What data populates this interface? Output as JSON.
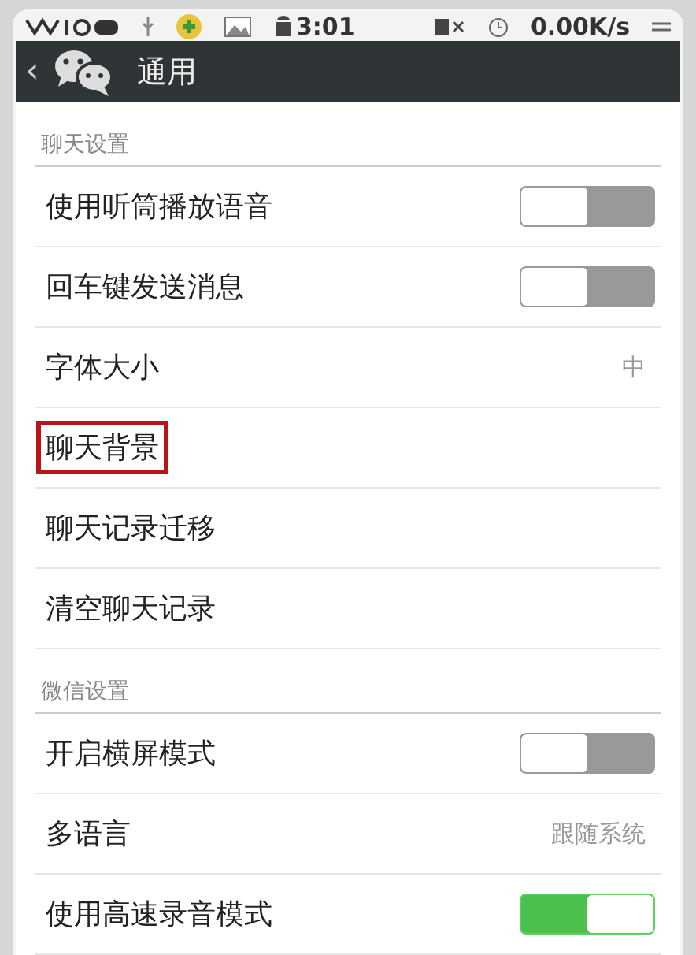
{
  "status_bar": {
    "time": "3:01",
    "speed": "0.00K/s"
  },
  "header": {
    "back": "‹",
    "title": "通用"
  },
  "sections": [
    {
      "title": "聊天设置",
      "items": [
        {
          "kind": "toggle",
          "label": "使用听筒播放语音",
          "on": false,
          "highlighted": false
        },
        {
          "kind": "toggle",
          "label": "回车键发送消息",
          "on": false,
          "highlighted": false
        },
        {
          "kind": "value",
          "label": "字体大小",
          "value": "中",
          "highlighted": false
        },
        {
          "kind": "plain",
          "label": "聊天背景",
          "highlighted": true
        },
        {
          "kind": "plain",
          "label": "聊天记录迁移",
          "highlighted": false
        },
        {
          "kind": "plain",
          "label": "清空聊天记录",
          "highlighted": false
        }
      ]
    },
    {
      "title": "微信设置",
      "items": [
        {
          "kind": "toggle",
          "label": "开启横屏模式",
          "on": false,
          "highlighted": false
        },
        {
          "kind": "value",
          "label": "多语言",
          "value": "跟随系统",
          "highlighted": false
        },
        {
          "kind": "toggle",
          "label": "使用高速录音模式",
          "on": true,
          "highlighted": false
        }
      ]
    }
  ]
}
